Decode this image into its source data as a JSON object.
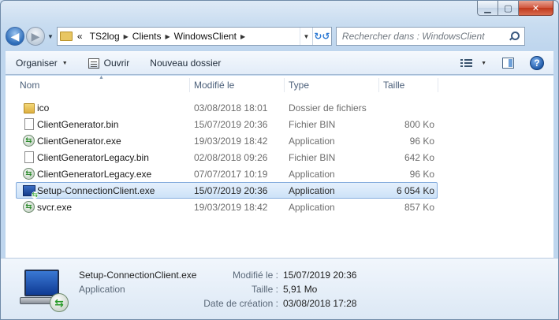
{
  "window": {
    "caption_buttons": {
      "minimize": "▁",
      "maximize": "▢",
      "close": "✕"
    }
  },
  "nav": {
    "back_icon": "back-arrow-icon",
    "back_glyph": "◀",
    "forward_glyph": "▶",
    "recent_glyph": "▼"
  },
  "address": {
    "overflow": "«",
    "crumbs": [
      "TS2log",
      "Clients",
      "WindowsClient"
    ],
    "sep_glyph": "▶",
    "dropdown_glyph": "▼",
    "refresh_glyph": "↻↺"
  },
  "search": {
    "placeholder": "Rechercher dans : WindowsClient"
  },
  "toolbar": {
    "organize_label": "Organiser",
    "open_label": "Ouvrir",
    "new_folder_label": "Nouveau dossier",
    "caret": "▼",
    "help_glyph": "?"
  },
  "columns": {
    "name": "Nom",
    "modified": "Modifié le",
    "type": "Type",
    "size": "Taille",
    "sort_glyph": "▲"
  },
  "files": [
    {
      "icon": "folder-icon",
      "name": "ico",
      "modified": "03/08/2018 18:01",
      "type": "Dossier de fichiers",
      "size": "",
      "selected": false
    },
    {
      "icon": "bin-file-icon",
      "name": "ClientGenerator.bin",
      "modified": "15/07/2019 20:36",
      "type": "Fichier BIN",
      "size": "800 Ko",
      "selected": false
    },
    {
      "icon": "exe-app-icon",
      "name": "ClientGenerator.exe",
      "modified": "19/03/2019 18:42",
      "type": "Application",
      "size": "96 Ko",
      "selected": false
    },
    {
      "icon": "bin-file-icon",
      "name": "ClientGeneratorLegacy.bin",
      "modified": "02/08/2018 09:26",
      "type": "Fichier BIN",
      "size": "642 Ko",
      "selected": false
    },
    {
      "icon": "exe-app-icon",
      "name": "ClientGeneratorLegacy.exe",
      "modified": "07/07/2017 10:19",
      "type": "Application",
      "size": "96 Ko",
      "selected": false
    },
    {
      "icon": "setup-app-icon",
      "name": "Setup-ConnectionClient.exe",
      "modified": "15/07/2019 20:36",
      "type": "Application",
      "size": "6 054 Ko",
      "selected": true
    },
    {
      "icon": "exe-app-icon",
      "name": "svcr.exe",
      "modified": "19/03/2019 18:42",
      "type": "Application",
      "size": "857 Ko",
      "selected": false
    }
  ],
  "details": {
    "name": "Setup-ConnectionClient.exe",
    "type": "Application",
    "modified_label": "Modifié le :",
    "modified_value": "15/07/2019 20:36",
    "size_label": "Taille :",
    "size_value": "5,91 Mo",
    "created_label": "Date de création :",
    "created_value": "03/08/2018 17:28",
    "badge_glyph": "⇆"
  },
  "colors": {
    "selection_bg": "#cde2f8",
    "selection_border": "#84acdd",
    "header_text": "#4c607a"
  }
}
